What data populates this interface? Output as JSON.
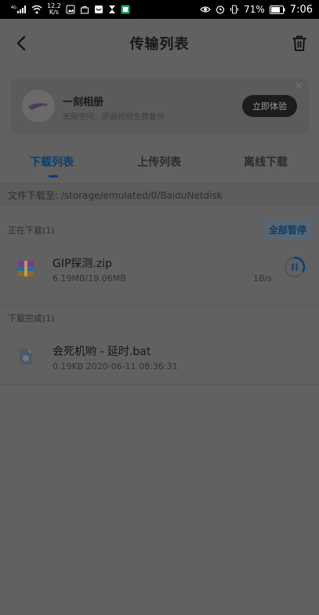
{
  "status_bar": {
    "network": "4G",
    "speed_value": "12.2",
    "speed_unit": "K/s",
    "battery": "71%",
    "time": "7:06",
    "icons_left": [
      "signal-icon",
      "wifi-icon",
      "gallery-icon",
      "bag-icon",
      "shopping-icon",
      "hourglass-icon",
      "app-icon"
    ],
    "icons_right": [
      "eye-icon",
      "alarm-icon",
      "vibrate-icon",
      "battery-icon"
    ]
  },
  "header": {
    "title": "传输列表",
    "back_icon": "chevron-left-icon",
    "trash_icon": "trash-icon"
  },
  "promo": {
    "title": "一刻相册",
    "subtitle": "无限空间，原画视频免费备份",
    "button": "立即体验",
    "close": "×"
  },
  "tabs": [
    {
      "label": "下载列表",
      "active": true
    },
    {
      "label": "上传列表",
      "active": false
    },
    {
      "label": "离线下载",
      "active": false
    }
  ],
  "path": "文件下载至: /storage/emulated/0/BaiduNetdisk",
  "downloading": {
    "label": "正在下载(1)",
    "pause_all": "全部暂停",
    "items": [
      {
        "name": "GIP探测.zip",
        "size": "6.19MB/19.06MB",
        "speed": "1B/s",
        "progress": 0.32,
        "icon": "zip-file-icon"
      }
    ]
  },
  "completed": {
    "label": "下载完成(1)",
    "items": [
      {
        "name": "会死机哟 - 延时.bat",
        "info": "0.19KB 2020-06-11 08:36:31",
        "icon": "bat-file-icon"
      }
    ]
  },
  "colors": {
    "accent": "#0a3f73",
    "overlay_bg": "#616161",
    "status_bar": "#000000"
  }
}
